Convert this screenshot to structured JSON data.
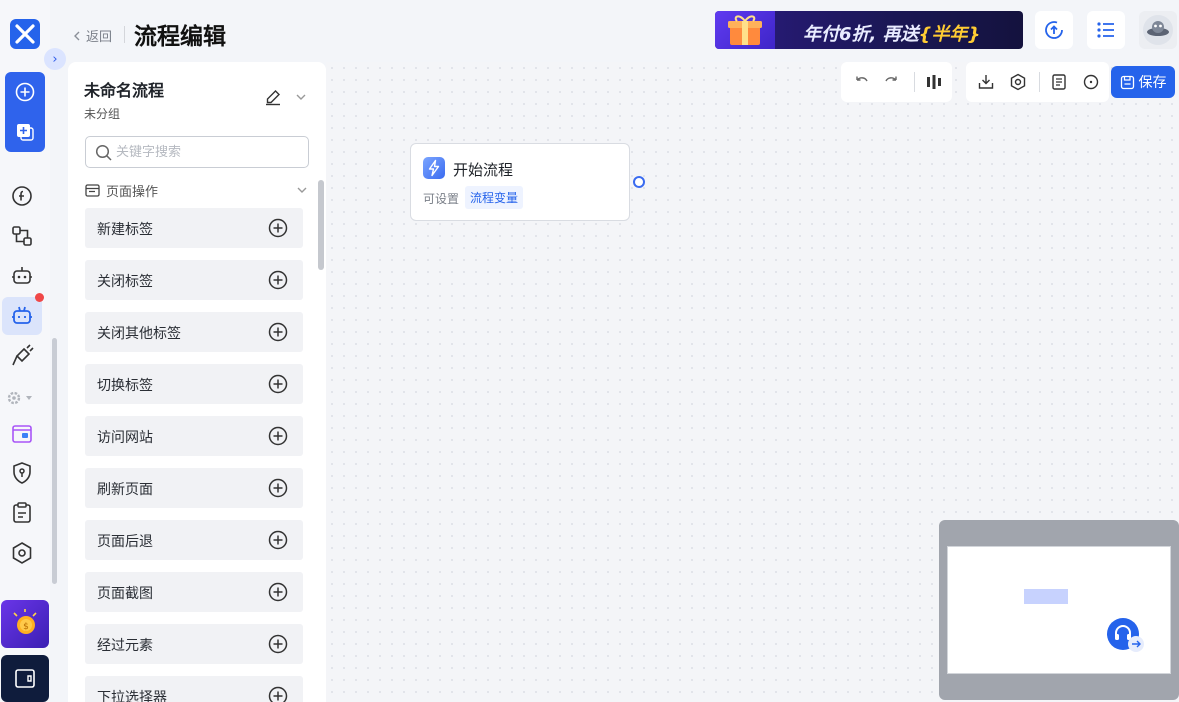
{
  "header": {
    "back_label": "返回",
    "title": "流程编辑",
    "promo": {
      "prefix": "年付6折, 再送",
      "highlight": "半年"
    }
  },
  "flow": {
    "name": "未命名流程",
    "group": "未分组"
  },
  "search": {
    "placeholder": "关键字搜索",
    "value": ""
  },
  "section": {
    "label": "页面操作"
  },
  "actions": [
    "新建标签",
    "关闭标签",
    "关闭其他标签",
    "切换标签",
    "访问网站",
    "刷新页面",
    "页面后退",
    "页面截图",
    "经过元素",
    "下拉选择器"
  ],
  "toolbar": {
    "save_label": "保存"
  },
  "node": {
    "title": "开始流程",
    "subtitle": "可设置",
    "link": "流程变量"
  },
  "colors": {
    "accent": "#2563eb",
    "notification": "#f04848"
  }
}
